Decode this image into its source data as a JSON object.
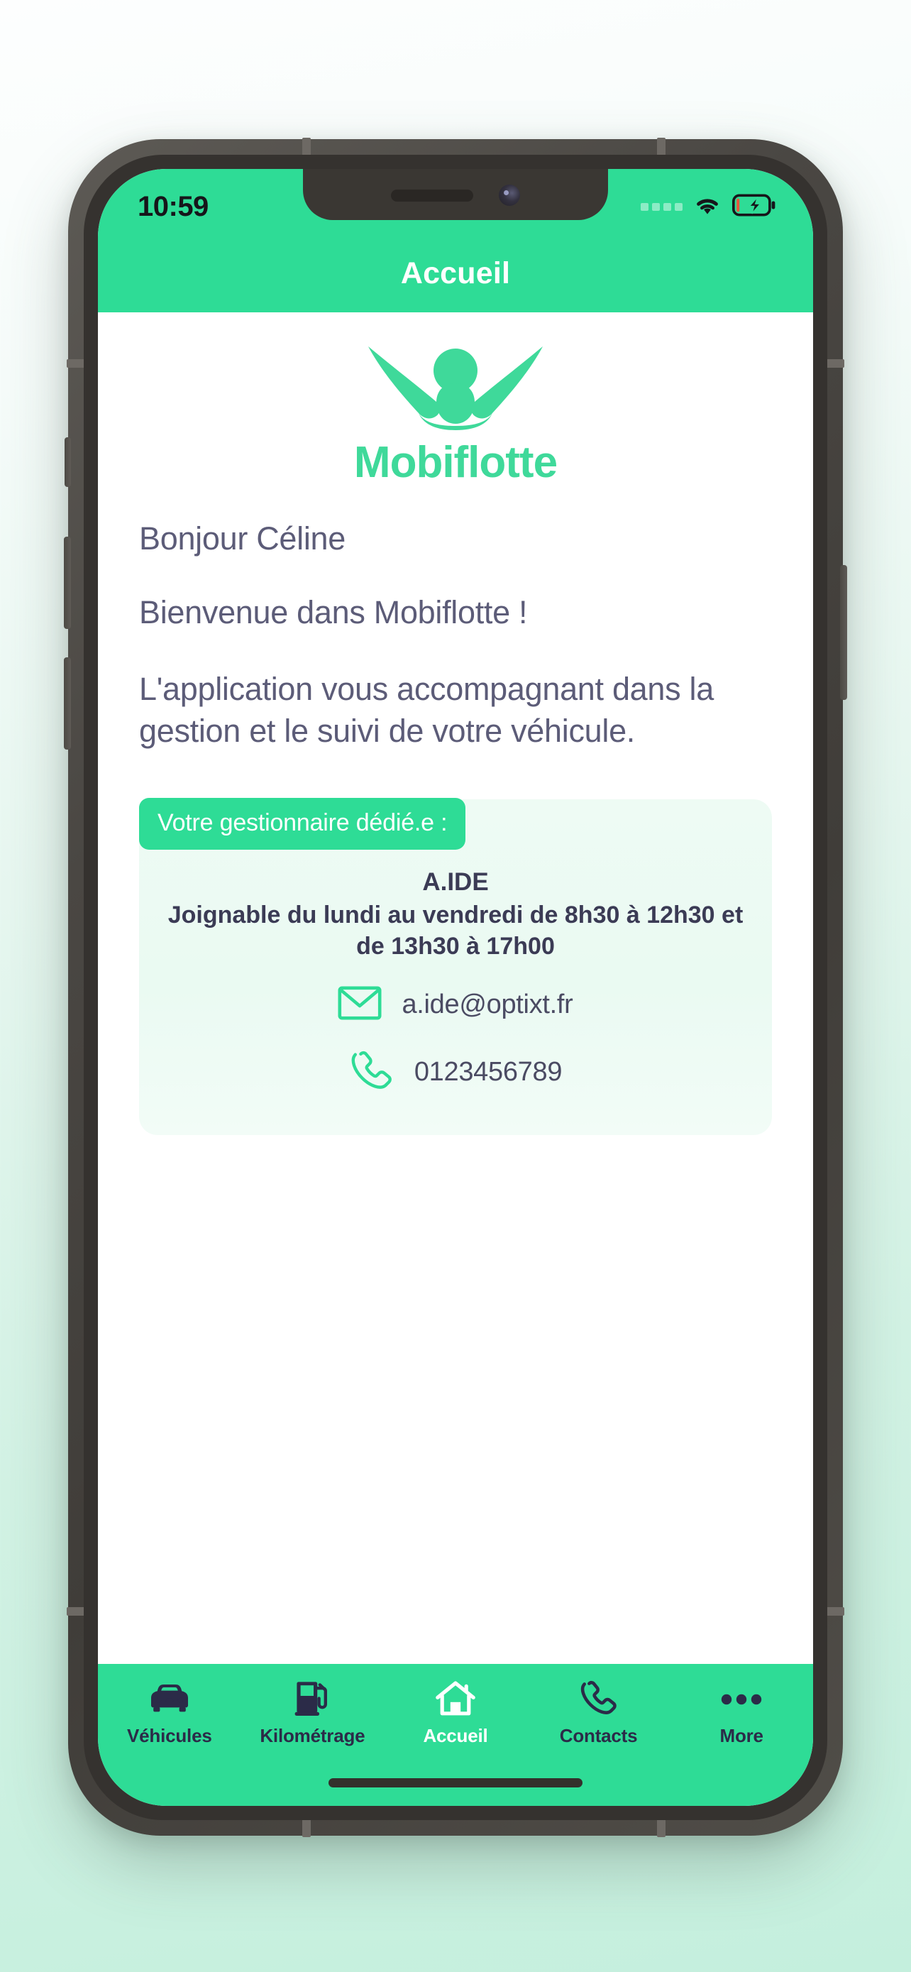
{
  "theme": {
    "accent_green": "#2EDC96",
    "logo_green": "#3FD99A",
    "text_navy": "#5c5c78",
    "card_mint": "#eefbf4",
    "nav_dark": "#2b2b48"
  },
  "status_bar": {
    "time": "10:59",
    "signal_icon": "signal-bars-icon",
    "wifi_icon": "wifi-icon",
    "battery_icon": "battery-charging-icon"
  },
  "header": {
    "title": "Accueil"
  },
  "logo": {
    "mark_name": "mobiflotte-bird-logo",
    "wordmark": "Mobiflotte"
  },
  "greeting": {
    "name_line": "Bonjour Céline",
    "welcome_line": "Bienvenue dans Mobiflotte !",
    "description": "L'application vous accompagnant dans la gestion et le suivi de votre véhicule."
  },
  "manager_card": {
    "badge": "Votre gestionnaire dédié.e :",
    "name": "A.IDE",
    "hours": "Joignable du lundi au vendredi de 8h30 à 12h30 et de 13h30 à 17h00",
    "email": {
      "icon": "envelope-icon",
      "value": "a.ide@optixt.fr"
    },
    "phone": {
      "icon": "phone-icon",
      "value": "0123456789"
    }
  },
  "bottom_nav": {
    "items": [
      {
        "label": "Véhicules",
        "icon": "car-icon",
        "active": false
      },
      {
        "label": "Kilométrage",
        "icon": "fuel-pump-icon",
        "active": false
      },
      {
        "label": "Accueil",
        "icon": "home-icon",
        "active": true
      },
      {
        "label": "Contacts",
        "icon": "phone-icon",
        "active": false
      },
      {
        "label": "More",
        "icon": "ellipsis-icon",
        "active": false
      }
    ]
  }
}
